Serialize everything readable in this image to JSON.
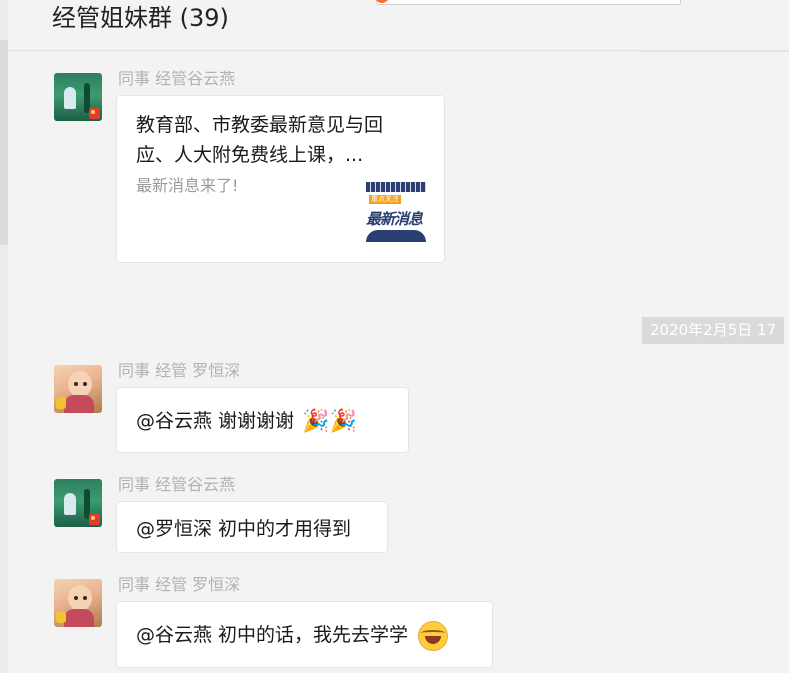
{
  "chat": {
    "title": "经管姐妹群 (39)"
  },
  "messages": {
    "m1": {
      "sender": "同事 经管谷云燕",
      "card_title": "教育部、市教委最新意见与回应、人大附免费线上课，...",
      "card_desc": "最新消息来了!",
      "thumb_tag": "重点关注",
      "thumb_text": "最新消息"
    },
    "timestamp": "2020年2月5日 17",
    "m2": {
      "sender": "同事 经管 罗恒深",
      "text": "@谷云燕 谢谢谢谢",
      "emoji": "🎉🎉"
    },
    "m3": {
      "sender": "同事 经管谷云燕",
      "text": "@罗恒深 初中的才用得到"
    },
    "m4": {
      "sender": "同事 经管 罗恒深",
      "text": "@谷云燕 初中的话，我先去学学",
      "emoji_name": "tears-of-joy-emoji"
    }
  },
  "colors": {
    "background": "#f3f3f3",
    "bubble": "#ffffff",
    "sender_text": "#b2b2b2",
    "timestamp_bg": "#dadada"
  }
}
